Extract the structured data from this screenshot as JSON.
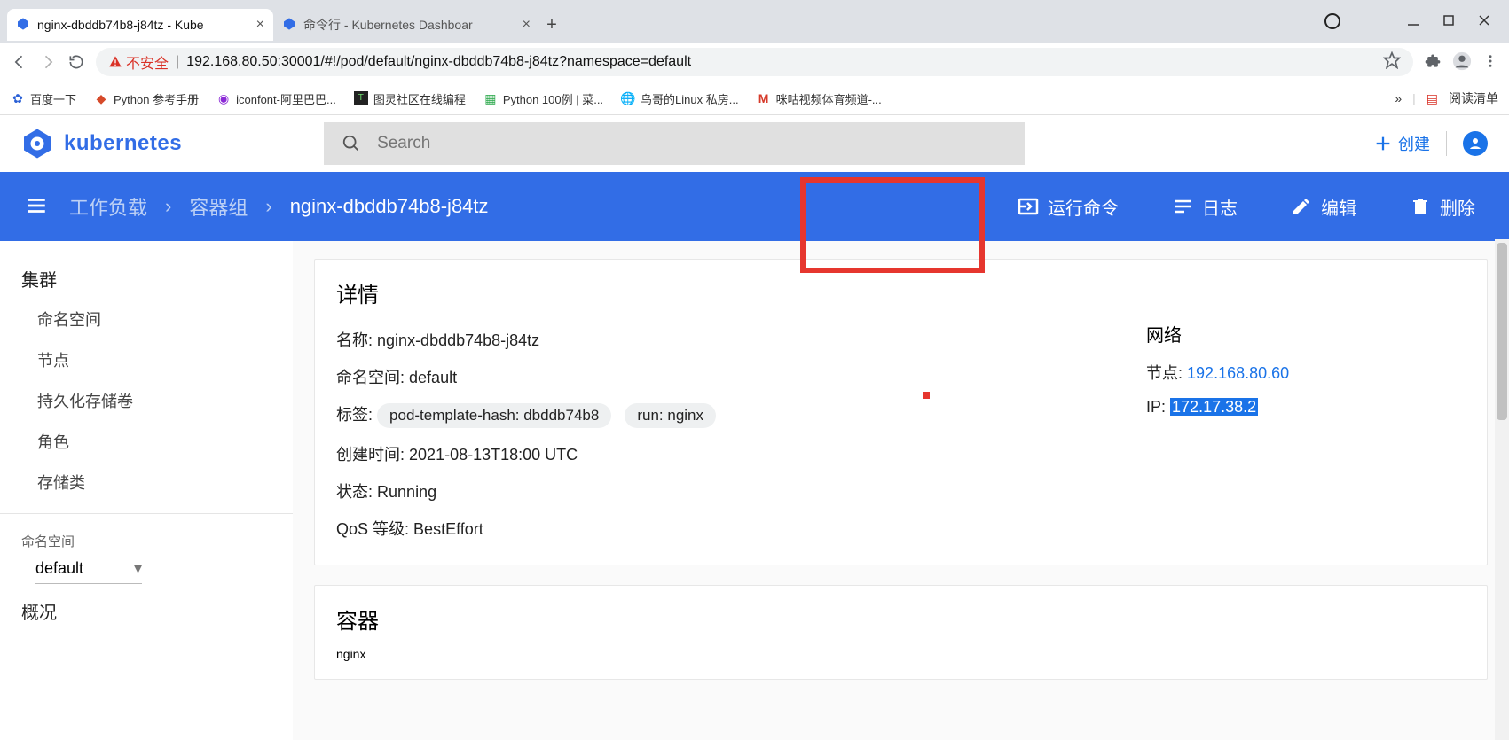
{
  "browser": {
    "tabs": [
      {
        "title": "nginx-dbddb74b8-j84tz - Kube"
      },
      {
        "title": "命令行 - Kubernetes Dashboar"
      }
    ],
    "security_text": "不安全",
    "url": "192.168.80.50:30001/#!/pod/default/nginx-dbddb74b8-j84tz?namespace=default",
    "bookmarks": [
      {
        "label": "百度一下"
      },
      {
        "label": "Python 参考手册"
      },
      {
        "label": "iconfont-阿里巴巴..."
      },
      {
        "label": "图灵社区在线编程"
      },
      {
        "label": "Python 100例 | 菜..."
      },
      {
        "label": "鸟哥的Linux 私房..."
      },
      {
        "label": "咪咕视频体育频道-..."
      }
    ],
    "reading_list": "阅读清单"
  },
  "dashboard": {
    "logo_text": "kubernetes",
    "search_placeholder": "Search",
    "create": "创建",
    "breadcrumb": {
      "item1": "工作负载",
      "item2": "容器组",
      "item3": "nginx-dbddb74b8-j84tz"
    },
    "actions": {
      "exec": "运行命令",
      "logs": "日志",
      "edit": "编辑",
      "delete": "删除"
    }
  },
  "sidebar": {
    "cluster_title": "集群",
    "items": [
      "命名空间",
      "节点",
      "持久化存储卷",
      "角色",
      "存储类"
    ],
    "ns_label": "命名空间",
    "ns_value": "default",
    "overview": "概况"
  },
  "details": {
    "title": "详情",
    "name_label": "名称:",
    "name_value": "nginx-dbddb74b8-j84tz",
    "ns_label": "命名空间:",
    "ns_value": "default",
    "labels_label": "标签:",
    "label_chip1": "pod-template-hash: dbddb74b8",
    "label_chip2": "run: nginx",
    "created_label": "创建时间:",
    "created_value": "2021-08-13T18:00 UTC",
    "status_label": "状态:",
    "status_value": "Running",
    "qos_label": "QoS 等级:",
    "qos_value": "BestEffort",
    "network_title": "网络",
    "node_label": "节点:",
    "node_value": "192.168.80.60",
    "ip_label": "IP:",
    "ip_value": "172.17.38.2"
  },
  "containers": {
    "title": "容器",
    "name": "nginx"
  }
}
